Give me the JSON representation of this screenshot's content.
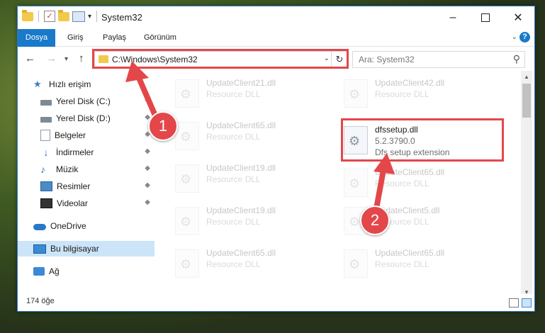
{
  "window": {
    "title": "System32",
    "minimize": "–",
    "close": "✕"
  },
  "ribbon": {
    "tabs": [
      "Dosya",
      "Giriş",
      "Paylaş",
      "Görünüm"
    ],
    "expand": "⌄",
    "help": "?"
  },
  "nav": {
    "back": "←",
    "forward": "→",
    "recent": "▾",
    "up": "↑",
    "address": "C:\\Windows\\System32",
    "address_dropdown": "⌄",
    "refresh": "↻",
    "search_placeholder": "Ara: System32",
    "search_icon": "⚲"
  },
  "sidebar": {
    "items": [
      {
        "label": "Hızlı erişim",
        "icon": "star-icon"
      },
      {
        "label": "Yerel Disk (C:)",
        "icon": "drive-icon",
        "pinned": true
      },
      {
        "label": "Yerel Disk (D:)",
        "icon": "drive-icon",
        "pinned": true
      },
      {
        "label": "Belgeler",
        "icon": "documents-icon",
        "pinned": true
      },
      {
        "label": "İndirmeler",
        "icon": "download-icon",
        "pinned": true
      },
      {
        "label": "Müzik",
        "icon": "music-icon",
        "pinned": true
      },
      {
        "label": "Resimler",
        "icon": "pictures-icon",
        "pinned": true
      },
      {
        "label": "Videolar",
        "icon": "videos-icon",
        "pinned": true
      },
      {
        "label": "OneDrive",
        "icon": "cloud-icon"
      },
      {
        "label": "Bu bilgisayar",
        "icon": "computer-icon",
        "selected": true
      },
      {
        "label": "Ağ",
        "icon": "network-icon"
      }
    ],
    "pin_glyph": "📌"
  },
  "files": {
    "col1": [
      {
        "name": "UpdateClient21.dll",
        "desc": "Resource DLL"
      },
      {
        "name": "UpdateClient65.dll",
        "desc": "Resource DLL"
      },
      {
        "name": "UpdateClient19.dll",
        "desc": "Resource DLL"
      },
      {
        "name": "UpdateClient19.dll",
        "desc": "Resource DLL"
      },
      {
        "name": "UpdateClient65.dll",
        "desc": "Resource DLL"
      }
    ],
    "col2": [
      {
        "name": "UpdateClient42.dll",
        "desc": "Resource DLL"
      },
      {
        "name": "UpdateClient65.dll",
        "desc": "Resource DLL"
      },
      {
        "name": "UpdateClient5.dll",
        "desc": "Resource DLL"
      },
      {
        "name": "UpdateClient65.dll",
        "desc": "Resource DLL"
      }
    ],
    "highlighted": {
      "name": "dfssetup.dll",
      "version": "5.2.3790.0",
      "desc": "Dfs setup extension"
    },
    "gear_glyph": "⚙"
  },
  "status": {
    "count": "174 öğe"
  },
  "annotations": {
    "step1": "1",
    "step2": "2",
    "color": "#e3474a"
  }
}
